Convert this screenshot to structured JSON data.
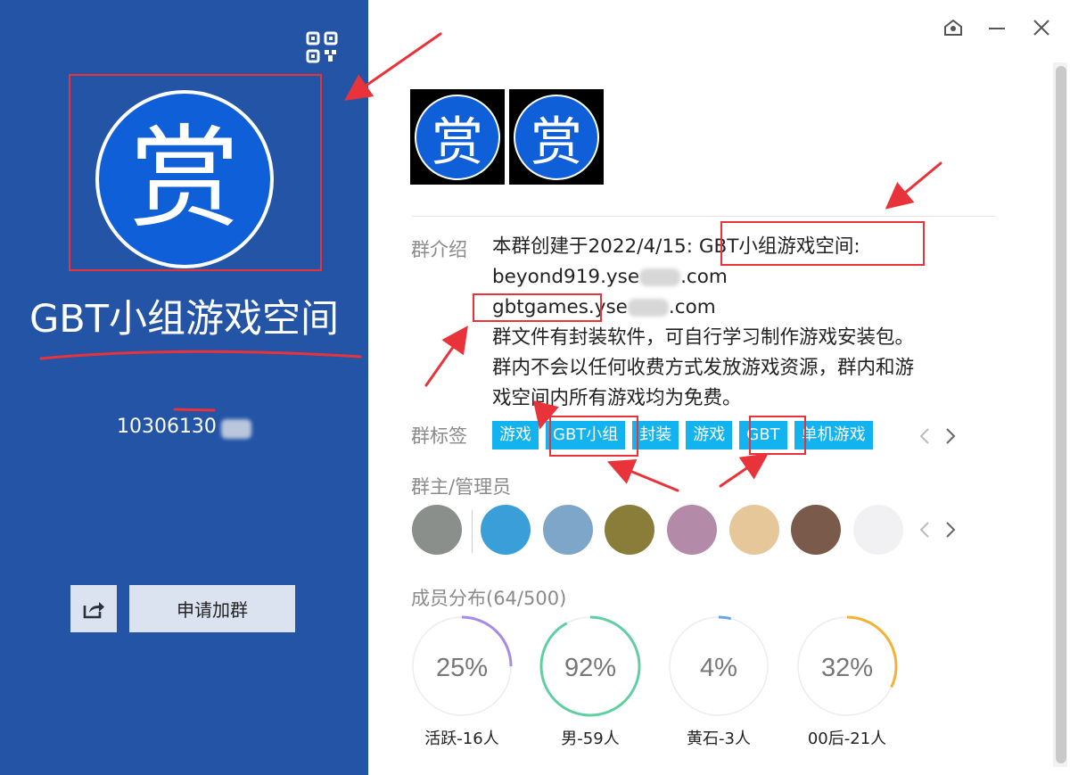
{
  "group": {
    "avatar_char": "赏",
    "name": "GBT小组游戏空间",
    "id_visible": "10306130"
  },
  "actions": {
    "join_label": "申请加群",
    "share_icon": "share-icon"
  },
  "icons": {
    "qr": "qr-code-icon",
    "window_settings": "window-settings-icon",
    "minimize": "minimize-icon",
    "close": "close-icon"
  },
  "intro": {
    "label": "群介绍",
    "line1_prefix": "本群创建于2022/4/15: ",
    "line1_highlight": "GBT小组游戏空间:",
    "line2_prefix": "beyond919.yse",
    "line2_suffix": ".com",
    "line3_highlight": "gbtgames",
    "line3_mid": ".yse",
    "line3_suffix": ".com",
    "line4": "群文件有封装软件，可自行学习制作游戏安装包。",
    "line5": "群内不会以任何收费方式发放游戏资源，群内和游",
    "line6": "戏空间内所有游戏均为免费。"
  },
  "tags": {
    "label": "群标签",
    "items": [
      "游戏",
      "GBT小组",
      "封装",
      "游戏",
      "GBT",
      "单机游戏"
    ]
  },
  "admins": {
    "label": "群主/管理员",
    "avatars": [
      {
        "color": "#8a8f8c"
      },
      {
        "color": "#3a9fd8"
      },
      {
        "color": "#7ea6c9"
      },
      {
        "color": "#8a7d3a"
      },
      {
        "color": "#b48aa9"
      },
      {
        "color": "#e6c79a"
      },
      {
        "color": "#7a5a4a"
      },
      {
        "color": "#f1f1f3"
      }
    ]
  },
  "members": {
    "label": "成员分布",
    "count": "(64/500)",
    "stats": [
      {
        "percent": 25,
        "text": "25%",
        "label": "活跃-16人",
        "color": "#a58ae6"
      },
      {
        "percent": 92,
        "text": "92%",
        "label": "男-59人",
        "color": "#5fcfa0"
      },
      {
        "percent": 4,
        "text": "4%",
        "label": "黄石-3人",
        "color": "#6aa3e8"
      },
      {
        "percent": 32,
        "text": "32%",
        "label": "00后-21人",
        "color": "#f2b233"
      }
    ]
  },
  "colors": {
    "panel_blue": "#2354a6",
    "tag_blue": "#12b3ee",
    "annotation_red": "#e8333a"
  }
}
